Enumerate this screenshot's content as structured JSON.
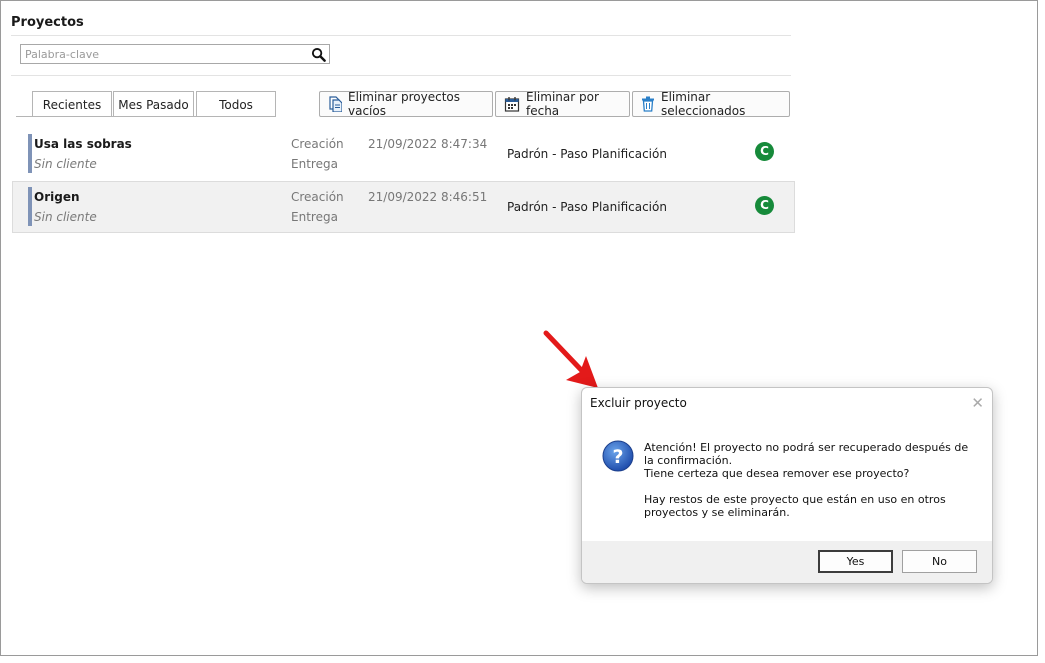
{
  "page": {
    "title": "Proyectos"
  },
  "search": {
    "placeholder": "Palabra-clave",
    "value": ""
  },
  "tabs": [
    {
      "label": "Recientes",
      "active": true
    },
    {
      "label": "Mes Pasado",
      "active": false
    },
    {
      "label": "Todos",
      "active": false
    }
  ],
  "toolbar": {
    "delete_empty": "Eliminar proyectos vacíos",
    "delete_by_date": "Eliminar por fecha",
    "delete_selected": "Eliminar seleccionados"
  },
  "projects": [
    {
      "name": "Usa las sobras",
      "client": "Sin cliente",
      "creation_label": "Creación",
      "delivery_label": "Entrega",
      "created": "21/09/2022 8:47:34",
      "stage": "Padrón - Paso Planificación",
      "status": "C",
      "selected": false
    },
    {
      "name": "Origen",
      "client": "Sin cliente",
      "creation_label": "Creación",
      "delivery_label": "Entrega",
      "created": "21/09/2022 8:46:51",
      "stage": "Padrón - Paso Planificación",
      "status": "C",
      "selected": true
    }
  ],
  "dialog": {
    "title": "Excluir proyecto",
    "line1": "Atención! El proyecto no podrá ser recuperado después de la confirmación.",
    "line2": "Tiene certeza que desea remover ese proyecto?",
    "line3": "Hay restos de este proyecto que están en uso en otros proyectos y se eliminarán.",
    "yes": "Yes",
    "no": "No"
  },
  "colors": {
    "status_green": "#168a3a",
    "row_marker": "#7f93b7",
    "arrow": "#e31a1a"
  },
  "icons": [
    "search-icon",
    "document-icon",
    "calendar-icon",
    "trash-icon",
    "question-icon",
    "close-icon",
    "pointer-arrow"
  ]
}
